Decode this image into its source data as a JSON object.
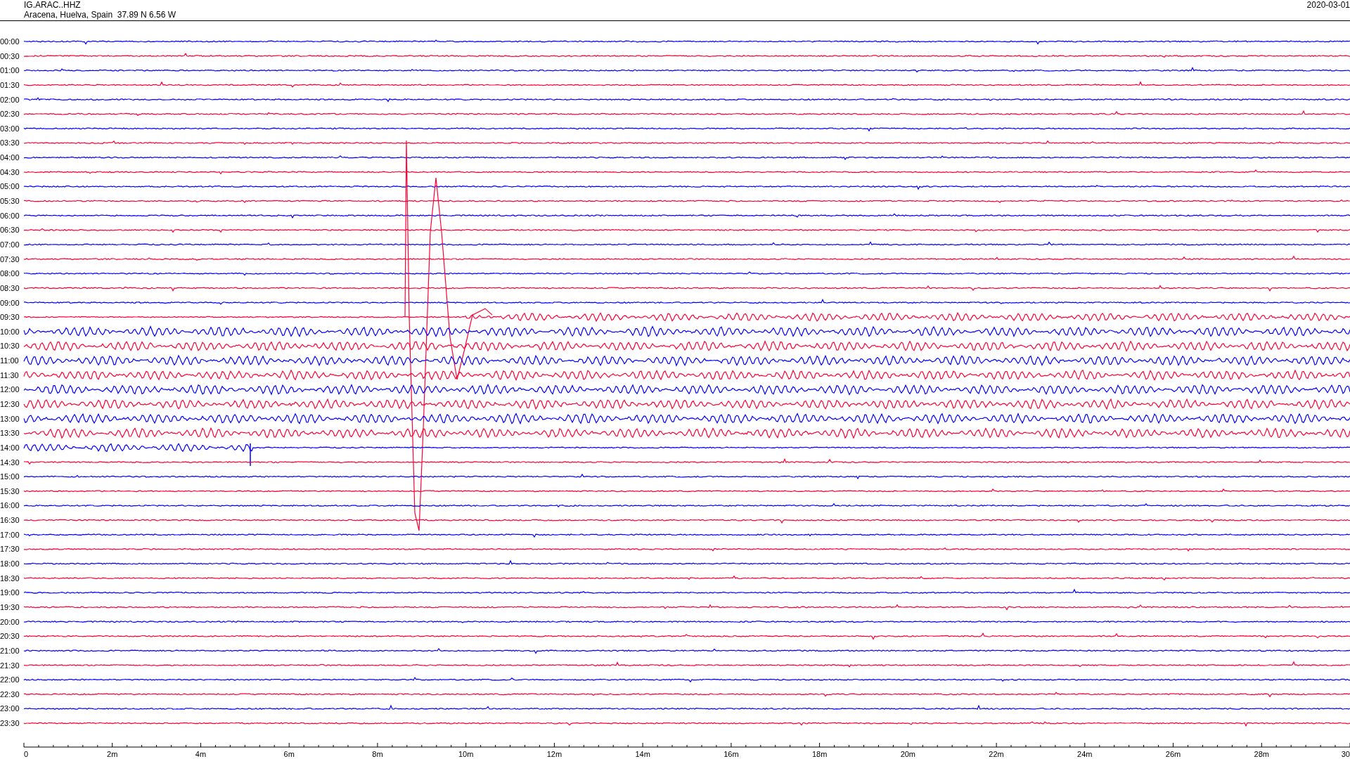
{
  "header": {
    "station": "IG.ARAC..HHZ",
    "location": "Aracena, Huelva, Spain  37.89 N 6.56 W",
    "date": "2020-03-01"
  },
  "rows": [
    {
      "time": "00:00",
      "color": "#0000ff",
      "kind": "flat"
    },
    {
      "time": "00:30",
      "color": "#ff0033",
      "kind": "flat"
    },
    {
      "time": "01:00",
      "color": "#0000ff",
      "kind": "flat"
    },
    {
      "time": "01:30",
      "color": "#ff0033",
      "kind": "flat"
    },
    {
      "time": "02:00",
      "color": "#0000ff",
      "kind": "flat"
    },
    {
      "time": "02:30",
      "color": "#ff0033",
      "kind": "flat"
    },
    {
      "time": "03:00",
      "color": "#0000ff",
      "kind": "flat"
    },
    {
      "time": "03:30",
      "color": "#ff0033",
      "kind": "flat"
    },
    {
      "time": "04:00",
      "color": "#0000ff",
      "kind": "flat"
    },
    {
      "time": "04:30",
      "color": "#ff0033",
      "kind": "flat"
    },
    {
      "time": "05:00",
      "color": "#0000ff",
      "kind": "flat"
    },
    {
      "time": "05:30",
      "color": "#ff0033",
      "kind": "flat"
    },
    {
      "time": "06:00",
      "color": "#0000ff",
      "kind": "flat"
    },
    {
      "time": "06:30",
      "color": "#ff0033",
      "kind": "flat"
    },
    {
      "time": "07:00",
      "color": "#0000ff",
      "kind": "flat"
    },
    {
      "time": "07:30",
      "color": "#ff0033",
      "kind": "flat"
    },
    {
      "time": "08:00",
      "color": "#0000ff",
      "kind": "flat"
    },
    {
      "time": "08:30",
      "color": "#ff0033",
      "kind": "flat"
    },
    {
      "time": "09:00",
      "color": "#0000ff",
      "kind": "flat"
    },
    {
      "time": "09:30",
      "color": "#ff0033",
      "kind": "onset"
    },
    {
      "time": "10:00",
      "color": "#0000ff",
      "kind": "wavy"
    },
    {
      "time": "10:30",
      "color": "#ff0033",
      "kind": "wavy"
    },
    {
      "time": "11:00",
      "color": "#0000ff",
      "kind": "wavy"
    },
    {
      "time": "11:30",
      "color": "#ff0033",
      "kind": "wavy"
    },
    {
      "time": "12:00",
      "color": "#0000ff",
      "kind": "wavy"
    },
    {
      "time": "12:30",
      "color": "#ff0033",
      "kind": "wavy"
    },
    {
      "time": "13:00",
      "color": "#0000ff",
      "kind": "wavy"
    },
    {
      "time": "13:30",
      "color": "#ff0033",
      "kind": "wavy"
    },
    {
      "time": "14:00",
      "color": "#0000ff",
      "kind": "decay"
    },
    {
      "time": "14:30",
      "color": "#ff0033",
      "kind": "flat"
    },
    {
      "time": "15:00",
      "color": "#0000ff",
      "kind": "flat"
    },
    {
      "time": "15:30",
      "color": "#ff0033",
      "kind": "flat"
    },
    {
      "time": "16:00",
      "color": "#0000ff",
      "kind": "flat"
    },
    {
      "time": "16:30",
      "color": "#ff0033",
      "kind": "flat"
    },
    {
      "time": "17:00",
      "color": "#0000ff",
      "kind": "flat"
    },
    {
      "time": "17:30",
      "color": "#ff0033",
      "kind": "flat"
    },
    {
      "time": "18:00",
      "color": "#0000ff",
      "kind": "flat"
    },
    {
      "time": "18:30",
      "color": "#ff0033",
      "kind": "flat"
    },
    {
      "time": "19:00",
      "color": "#0000ff",
      "kind": "flat"
    },
    {
      "time": "19:30",
      "color": "#ff0033",
      "kind": "flat"
    },
    {
      "time": "20:00",
      "color": "#0000ff",
      "kind": "flat"
    },
    {
      "time": "20:30",
      "color": "#ff0033",
      "kind": "flat"
    },
    {
      "time": "21:00",
      "color": "#0000ff",
      "kind": "flat"
    },
    {
      "time": "21:30",
      "color": "#ff0033",
      "kind": "flat"
    },
    {
      "time": "22:00",
      "color": "#0000ff",
      "kind": "flat"
    },
    {
      "time": "22:30",
      "color": "#ff0033",
      "kind": "flat"
    },
    {
      "time": "23:00",
      "color": "#0000ff",
      "kind": "flat"
    },
    {
      "time": "23:30",
      "color": "#ff0033",
      "kind": "flat"
    }
  ],
  "axis_labels": [
    "0",
    "2m",
    "4m",
    "6m",
    "8m",
    "10m",
    "12m",
    "14m",
    "16m",
    "18m",
    "20m",
    "22m",
    "24m",
    "26m",
    "28m",
    "30"
  ]
}
